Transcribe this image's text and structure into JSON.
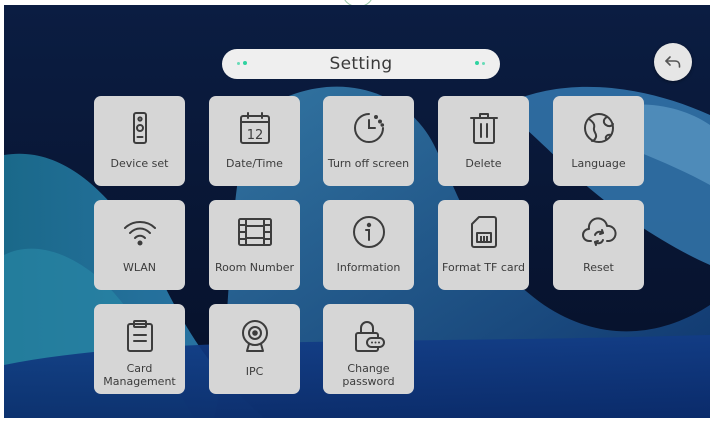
{
  "header": {
    "title": "Setting"
  },
  "back_button": {
    "icon": "back-arrow-icon"
  },
  "tiles": [
    {
      "id": "device-set",
      "label": "Device set",
      "icon": "intercom-device-icon"
    },
    {
      "id": "date-time",
      "label": "Date/Time",
      "icon": "calendar-icon",
      "icon_text": "12"
    },
    {
      "id": "turn-off-screen",
      "label": "Turn off screen",
      "icon": "timer-icon"
    },
    {
      "id": "delete",
      "label": "Delete",
      "icon": "trash-icon"
    },
    {
      "id": "language",
      "label": "Language",
      "icon": "globe-icon"
    },
    {
      "id": "wlan",
      "label": "WLAN",
      "icon": "wifi-icon"
    },
    {
      "id": "room-number",
      "label": "Room Number",
      "icon": "film-strip-icon"
    },
    {
      "id": "information",
      "label": "Information",
      "icon": "info-icon"
    },
    {
      "id": "format-tf-card",
      "label": "Format TF card",
      "icon": "sd-card-icon"
    },
    {
      "id": "reset",
      "label": "Reset",
      "icon": "cloud-sync-icon"
    },
    {
      "id": "card-management",
      "label": "Card Management",
      "label_lines": [
        "Card",
        "Management"
      ],
      "icon": "clipboard-icon"
    },
    {
      "id": "ipc",
      "label": "IPC",
      "icon": "webcam-icon"
    },
    {
      "id": "change-password",
      "label": "Change password",
      "label_lines": [
        "Change",
        "password"
      ],
      "icon": "lock-icon"
    }
  ],
  "colors": {
    "accent": "#2fd3a0",
    "tile_bg": "#d6d6d6",
    "icon_stroke": "#3d3d3d",
    "background": "#081634"
  }
}
